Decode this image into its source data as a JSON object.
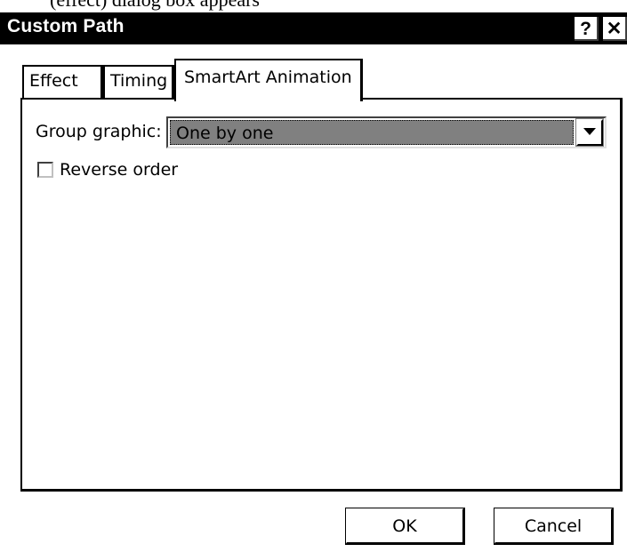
{
  "window": {
    "title": "Custom Path",
    "help_label": "?",
    "close_label": "✕",
    "caption_sliver": "(effect) dialog box appears"
  },
  "tabs": [
    {
      "label": "Effect",
      "active": false
    },
    {
      "label": "Timing",
      "active": false
    },
    {
      "label": "SmartArt Animation",
      "active": true
    }
  ],
  "panel": {
    "group_graphic_label": "Group graphic:",
    "group_graphic_value": "One by one",
    "reverse_order_label": "Reverse order",
    "reverse_order_checked": false
  },
  "buttons": {
    "ok_label": "OK",
    "cancel_label": "Cancel"
  },
  "icons": {
    "dropdown": "chevron-down-icon"
  }
}
